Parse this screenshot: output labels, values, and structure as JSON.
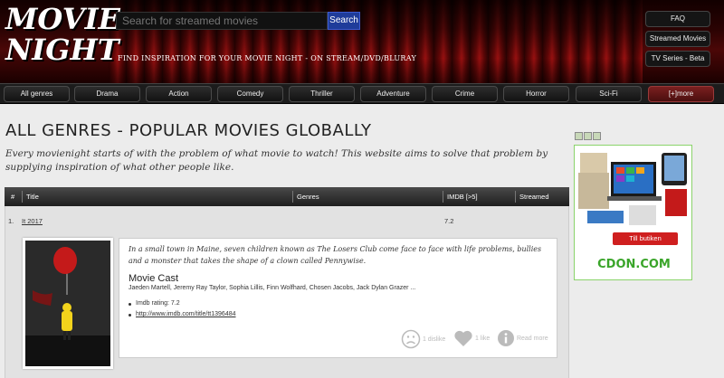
{
  "header": {
    "logo_line1": "MOVIE",
    "logo_line2": "NIGHT",
    "search_placeholder": "Search for streamed movies",
    "search_button": "Search",
    "tagline": "FIND INSPIRATION FOR YOUR MOVIE NIGHT - ON STREAM/DVD/BLURAY",
    "side_links": [
      "FAQ",
      "Streamed Movies",
      "TV Series - Beta"
    ]
  },
  "nav": {
    "items": [
      "All genres",
      "Drama",
      "Action",
      "Comedy",
      "Thriller",
      "Adventure",
      "Crime",
      "Horror",
      "Sci-Fi",
      "[+]more"
    ]
  },
  "main": {
    "title": "ALL GENRES - POPULAR MOVIES GLOBALLY",
    "intro": "Every movienight starts of with the problem of what movie to watch! This website aims to solve that problem by supplying inspiration of what other people like.",
    "table_headers": {
      "num": "#",
      "title": "Title",
      "genres": "Genres",
      "imdb": "IMDB [>5]",
      "streamed": "Streamed"
    },
    "rows": [
      {
        "num": "1.",
        "title": "It 2017",
        "rating": "7.2",
        "synopsis": "In a small town in Maine, seven children known as The Losers Club come face to face with life problems, bullies and a monster that takes the shape of a clown called Pennywise.",
        "cast_title": "Movie Cast",
        "cast": "Jaeden Martell, Jeremy Ray Taylor, Sophia Lillis, Finn Wolfhard, Chosen Jacobs, Jack Dylan Grazer ...",
        "imdb_rating": "Imdb rating: 7.2",
        "imdb_link": "http://www.imdb.com/title/tt1396484",
        "dislike_label": "1 dislike",
        "like_label": "1 like",
        "readmore_label": "Read more"
      }
    ]
  },
  "ad": {
    "button": "Till butiken",
    "brand": "CDON.COM"
  },
  "colors": {
    "accent_red": "#b51414",
    "search_blue": "#1f3c9a",
    "ad_green": "#3aa52a"
  }
}
